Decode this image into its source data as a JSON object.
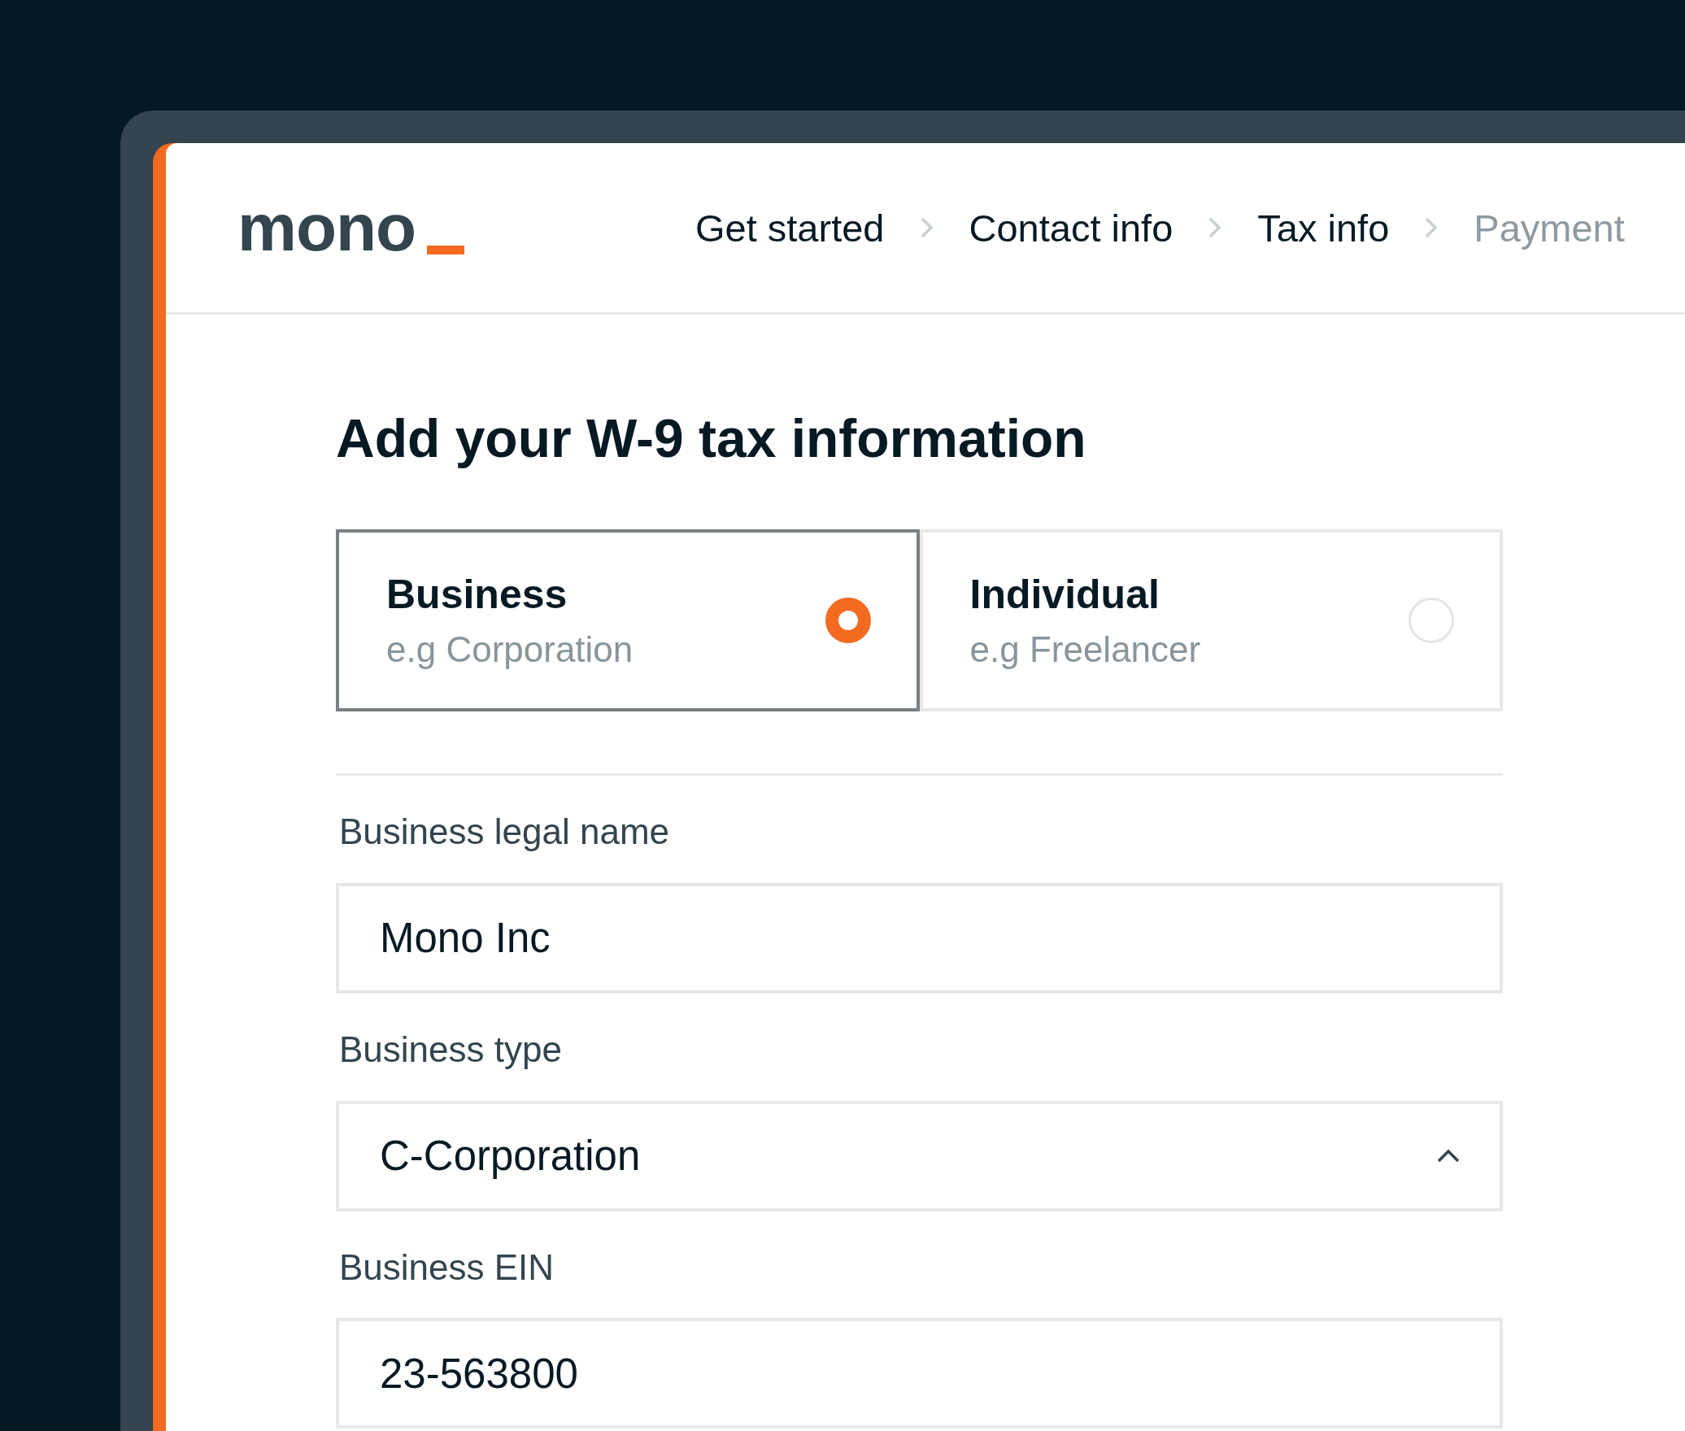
{
  "logo": {
    "text": "mono"
  },
  "steps": [
    {
      "label": "Get started",
      "disabled": false
    },
    {
      "label": "Contact info",
      "disabled": false
    },
    {
      "label": "Tax info",
      "disabled": false
    },
    {
      "label": "Payment",
      "disabled": true
    }
  ],
  "title": "Add your W-9 tax information",
  "entity_types": [
    {
      "label": "Business",
      "hint": "e.g Corporation",
      "selected": true
    },
    {
      "label": "Individual",
      "hint": "e.g Freelancer",
      "selected": false
    }
  ],
  "fields": [
    {
      "kind": "text",
      "label": "Business legal name",
      "value": "Mono Inc"
    },
    {
      "kind": "select",
      "label": "Business type",
      "value": "C-Corporation"
    },
    {
      "kind": "text",
      "label": "Business EIN",
      "value": "23-563800"
    }
  ]
}
